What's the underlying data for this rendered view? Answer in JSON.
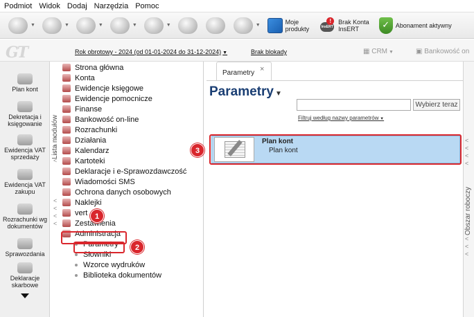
{
  "menu": {
    "items": [
      "Podmiot",
      "Widok",
      "Dodaj",
      "Narzędzia",
      "Pomoc"
    ]
  },
  "toolbar": {
    "moje_produkty_1": "Moje",
    "moje_produkty_2": "produkty",
    "brak_konta_1": "Brak Konta",
    "brak_konta_2": "InsERT",
    "insert_badge": "!",
    "insert_logo": "InsERT",
    "abonament": "Abonament aktywny"
  },
  "subbar": {
    "logo": "GT",
    "year": "Rok obrotowy - 2024  (od 01-01-2024 do 31-12-2024)",
    "blokady": "Brak blokady",
    "crm": "CRM",
    "bank": "Bankowość on"
  },
  "sidebar": {
    "items": [
      {
        "l1": "Plan kont",
        "l2": ""
      },
      {
        "l1": "Dekretacja i",
        "l2": "księgowanie"
      },
      {
        "l1": "Ewidencja VAT",
        "l2": "sprzedaży"
      },
      {
        "l1": "Ewidencja VAT",
        "l2": "zakupu"
      },
      {
        "l1": "Rozrachunki wg",
        "l2": "dokumentów"
      },
      {
        "l1": "Sprawozdania",
        "l2": ""
      },
      {
        "l1": "Deklaracje",
        "l2": "skarbowe"
      }
    ]
  },
  "modules": {
    "label": "Lista modułów",
    "items": [
      "Strona główna",
      "Konta",
      "Ewidencje księgowe",
      "Ewidencje pomocnicze",
      "Finanse",
      "Bankowość on-line",
      "Rozrachunki",
      "Działania",
      "Kalendarz",
      "Kartoteki",
      "Deklaracje i e-Sprawozdawczość",
      "Wiadomości SMS",
      "Ochrona danych osobowych",
      "Naklejki",
      "vert",
      "Zestawienia",
      "Administracja"
    ],
    "subitems": [
      "Parametry",
      "Słowniki",
      "Wzorce wydruków",
      "Biblioteka dokumentów"
    ]
  },
  "tab": {
    "label": "Parametry",
    "close": "×"
  },
  "content": {
    "title": "Parametry",
    "search_placeholder": "",
    "search_button": "Wybierz teraz",
    "filter_link": "Filtruj według nazwy parametrów",
    "row_title": "Plan kont",
    "row_sub": "Plan kont"
  },
  "rightrail": {
    "label": "Obszar roboczy"
  },
  "annotations": {
    "b1": "1",
    "b2": "2",
    "b3": "3",
    "color": "#d9262c"
  }
}
